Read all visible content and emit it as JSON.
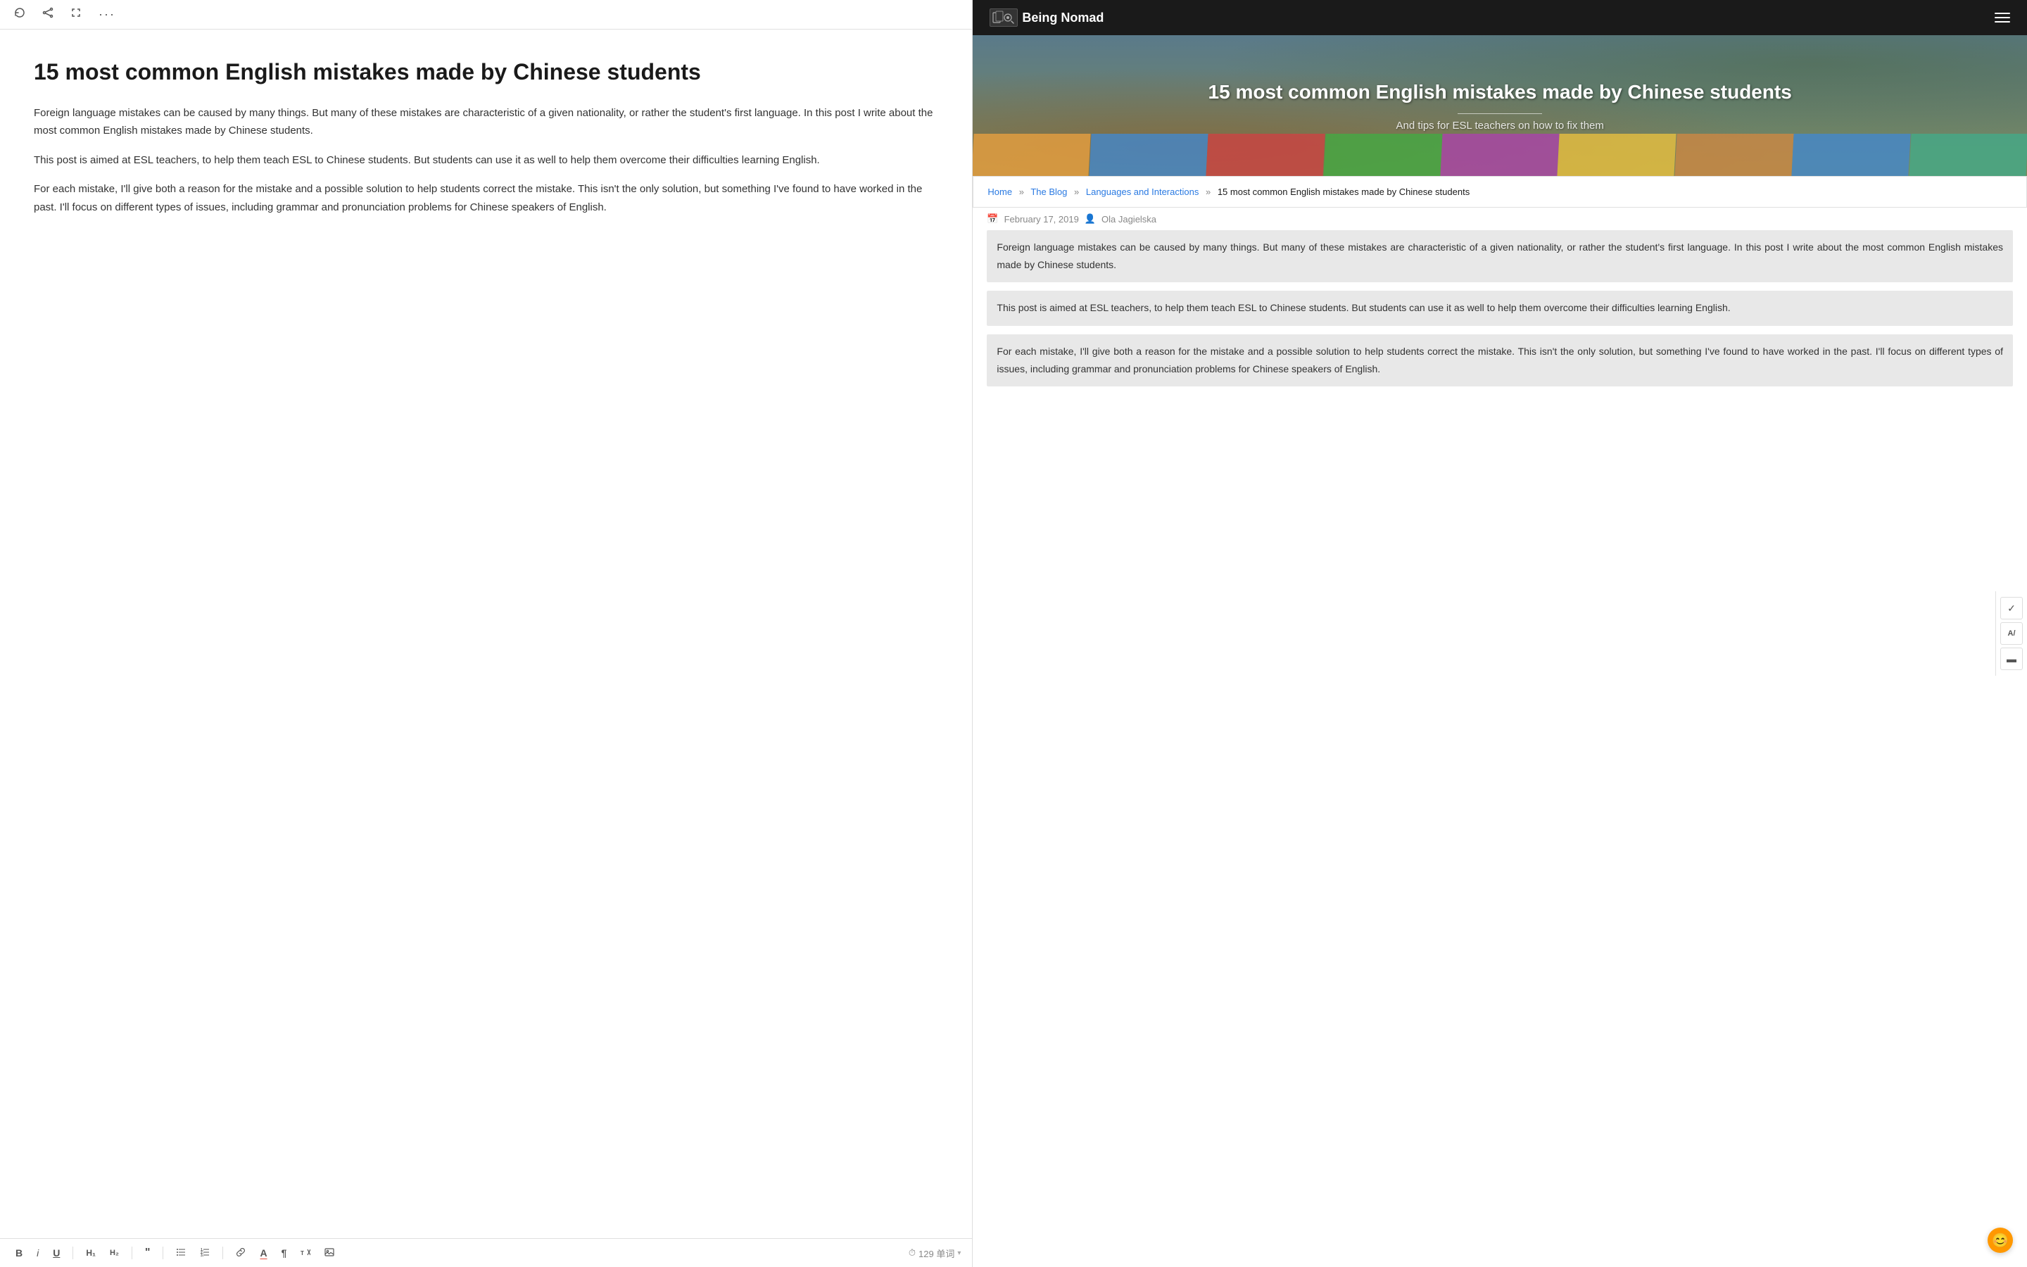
{
  "toolbar": {
    "refresh_title": "Refresh",
    "share_title": "Share",
    "expand_title": "Expand",
    "more_title": "More options"
  },
  "editor": {
    "title": "15 most common English mistakes made by Chinese students",
    "paragraphs": [
      "Foreign language mistakes can be caused by many things. But many of these mistakes are characteristic of a given nationality, or rather the student's first language. In this post I write about the most common English mistakes made by Chinese students.",
      "This post is aimed at ESL teachers, to help them teach ESL to Chinese students. But students can use it as well to help them overcome their difficulties learning English.",
      "For each mistake, I'll give both a reason for the mistake and a possible solution to help students correct the mistake. This isn't the only solution, but something I've found to have worked in the past. I'll focus on different types of issues, including grammar and pronunciation problems for Chinese speakers of English."
    ],
    "word_count": "129 单词",
    "format_buttons": [
      "B",
      "I",
      "U",
      "H1",
      "H2",
      "“",
      "≡",
      "≣",
      "⚇",
      "A",
      "¶",
      "↺",
      "⊡"
    ]
  },
  "site": {
    "logo_text": "Being Nomad",
    "nav_icon": "☰"
  },
  "hero": {
    "title": "15 most common English mistakes made by Chinese students",
    "subtitle": "And tips for ESL teachers on how to fix them"
  },
  "breadcrumb": {
    "home": "Home",
    "sep1": "»",
    "blog": "The Blog",
    "sep2": "»",
    "category": "Languages and Interactions",
    "sep3": "»",
    "current": "15 most common English mistakes made by Chinese students"
  },
  "post_meta": {
    "date": "February 17, 2019",
    "author": "Ola Jagielska"
  },
  "article": {
    "paragraphs": [
      "Foreign language mistakes can be caused by many things. But many of these mistakes are characteristic of a given nationality, or rather the student's first language. In this post I write about the most common English mistakes made by Chinese students.",
      "This post is aimed at ESL teachers, to help them teach ESL to Chinese students. But students can use it as well to help them overcome their difficulties learning English.",
      "For each mistake, I'll give both a reason for the mistake and a possible solution to help students correct the mistake. This isn't the only solution, but something I've found to have worked in the past. I'll focus on different types of issues, including grammar and pronunciation problems for Chinese speakers of English."
    ]
  },
  "sidebar_icons": {
    "check": "✓",
    "text": "A/",
    "menu": "▬"
  },
  "emoji": "😊"
}
